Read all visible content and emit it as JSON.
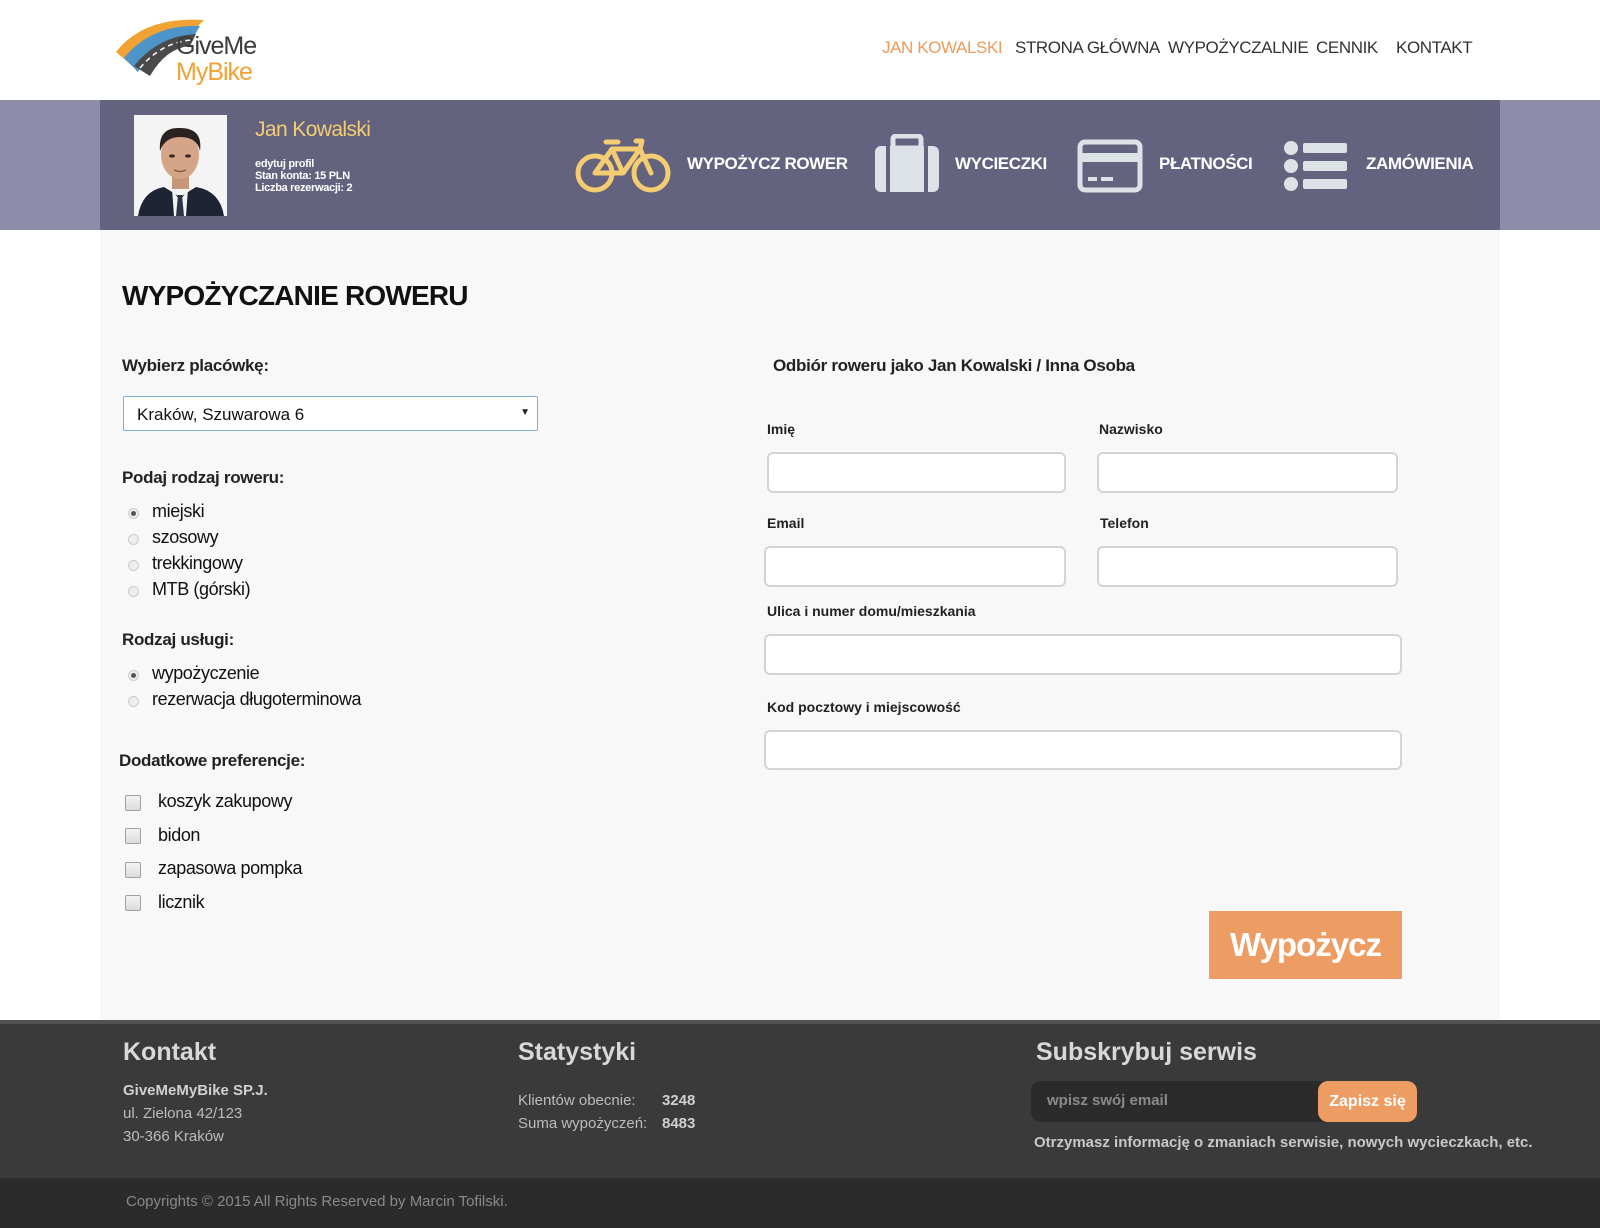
{
  "brand": {
    "line1": "GiveMe",
    "line2": "MyBike"
  },
  "nav": {
    "user": "JAN KOWALSKI",
    "home": "STRONA GŁÓWNA",
    "shops": "WYPOŻYCZALNIE",
    "prices": "CENNIK",
    "contact": "KONTAKT"
  },
  "profile": {
    "name": "Jan Kowalski",
    "edit": "edytuj profil",
    "balance": "Stan konta:  15 PLN",
    "reservations": "Liczba rezerwacji: 2"
  },
  "quick_actions": {
    "rent": "WYPOŻYCZ ROWER",
    "trips": "WYCIECZKI",
    "payments": "PŁATNOŚCI",
    "orders": "ZAMÓWIENIA"
  },
  "colors": {
    "accent": "#ed9d63",
    "band": "#63627f",
    "band_side": "#8d8cab",
    "user_name": "#f4cd73",
    "footer": "#3a3a3a"
  },
  "form": {
    "title": "WYPOŻYCZANIE ROWERU",
    "shop_label": "Wybierz  placówkę:",
    "shop_value": "Kraków, Szuwarowa 6",
    "bike_label": "Podaj rodzaj roweru:",
    "bike_options": [
      "miejski",
      "szosowy",
      "trekkingowy",
      "MTB (górski)"
    ],
    "service_label": "Rodzaj usługi:",
    "service_options": [
      "wypożyczenie",
      "rezerwacja długoterminowa"
    ],
    "prefs_label": "Dodatkowe preferencje:",
    "prefs_options": [
      "koszyk zakupowy",
      "bidon",
      "zapasowa pompka",
      "licznik"
    ],
    "pickup_heading": "Odbiór roweru jako Jan Kowalski / Inna Osoba",
    "first_name": "Imię",
    "last_name": "Nazwisko",
    "email": "Email",
    "phone": "Telefon",
    "street": "Ulica i numer domu/mieszkania",
    "postal": "Kod pocztowy i miejscowość",
    "submit": "Wypożycz"
  },
  "footer": {
    "contact_title": "Kontakt",
    "company": "GiveMeMyBike SP.J.",
    "address1": "ul. Zielona 42/123",
    "address2": "30-366 Kraków",
    "stats_title": "Statystyki",
    "clients_label": "Klientów obecnie:",
    "clients_value": "3248",
    "rentals_label": "Suma wypożyczeń:",
    "rentals_value": "8483",
    "subscribe_title": "Subskrybuj serwis",
    "email_placeholder": "wpisz swój email",
    "subscribe_button": "Zapisz się",
    "subscribe_info": "Otrzymasz informację o zmaniach serwisie, nowych wycieczkach, etc.",
    "copyright": "Copyrights © 2015 All Rights Reserved by Marcin Tofilski."
  }
}
